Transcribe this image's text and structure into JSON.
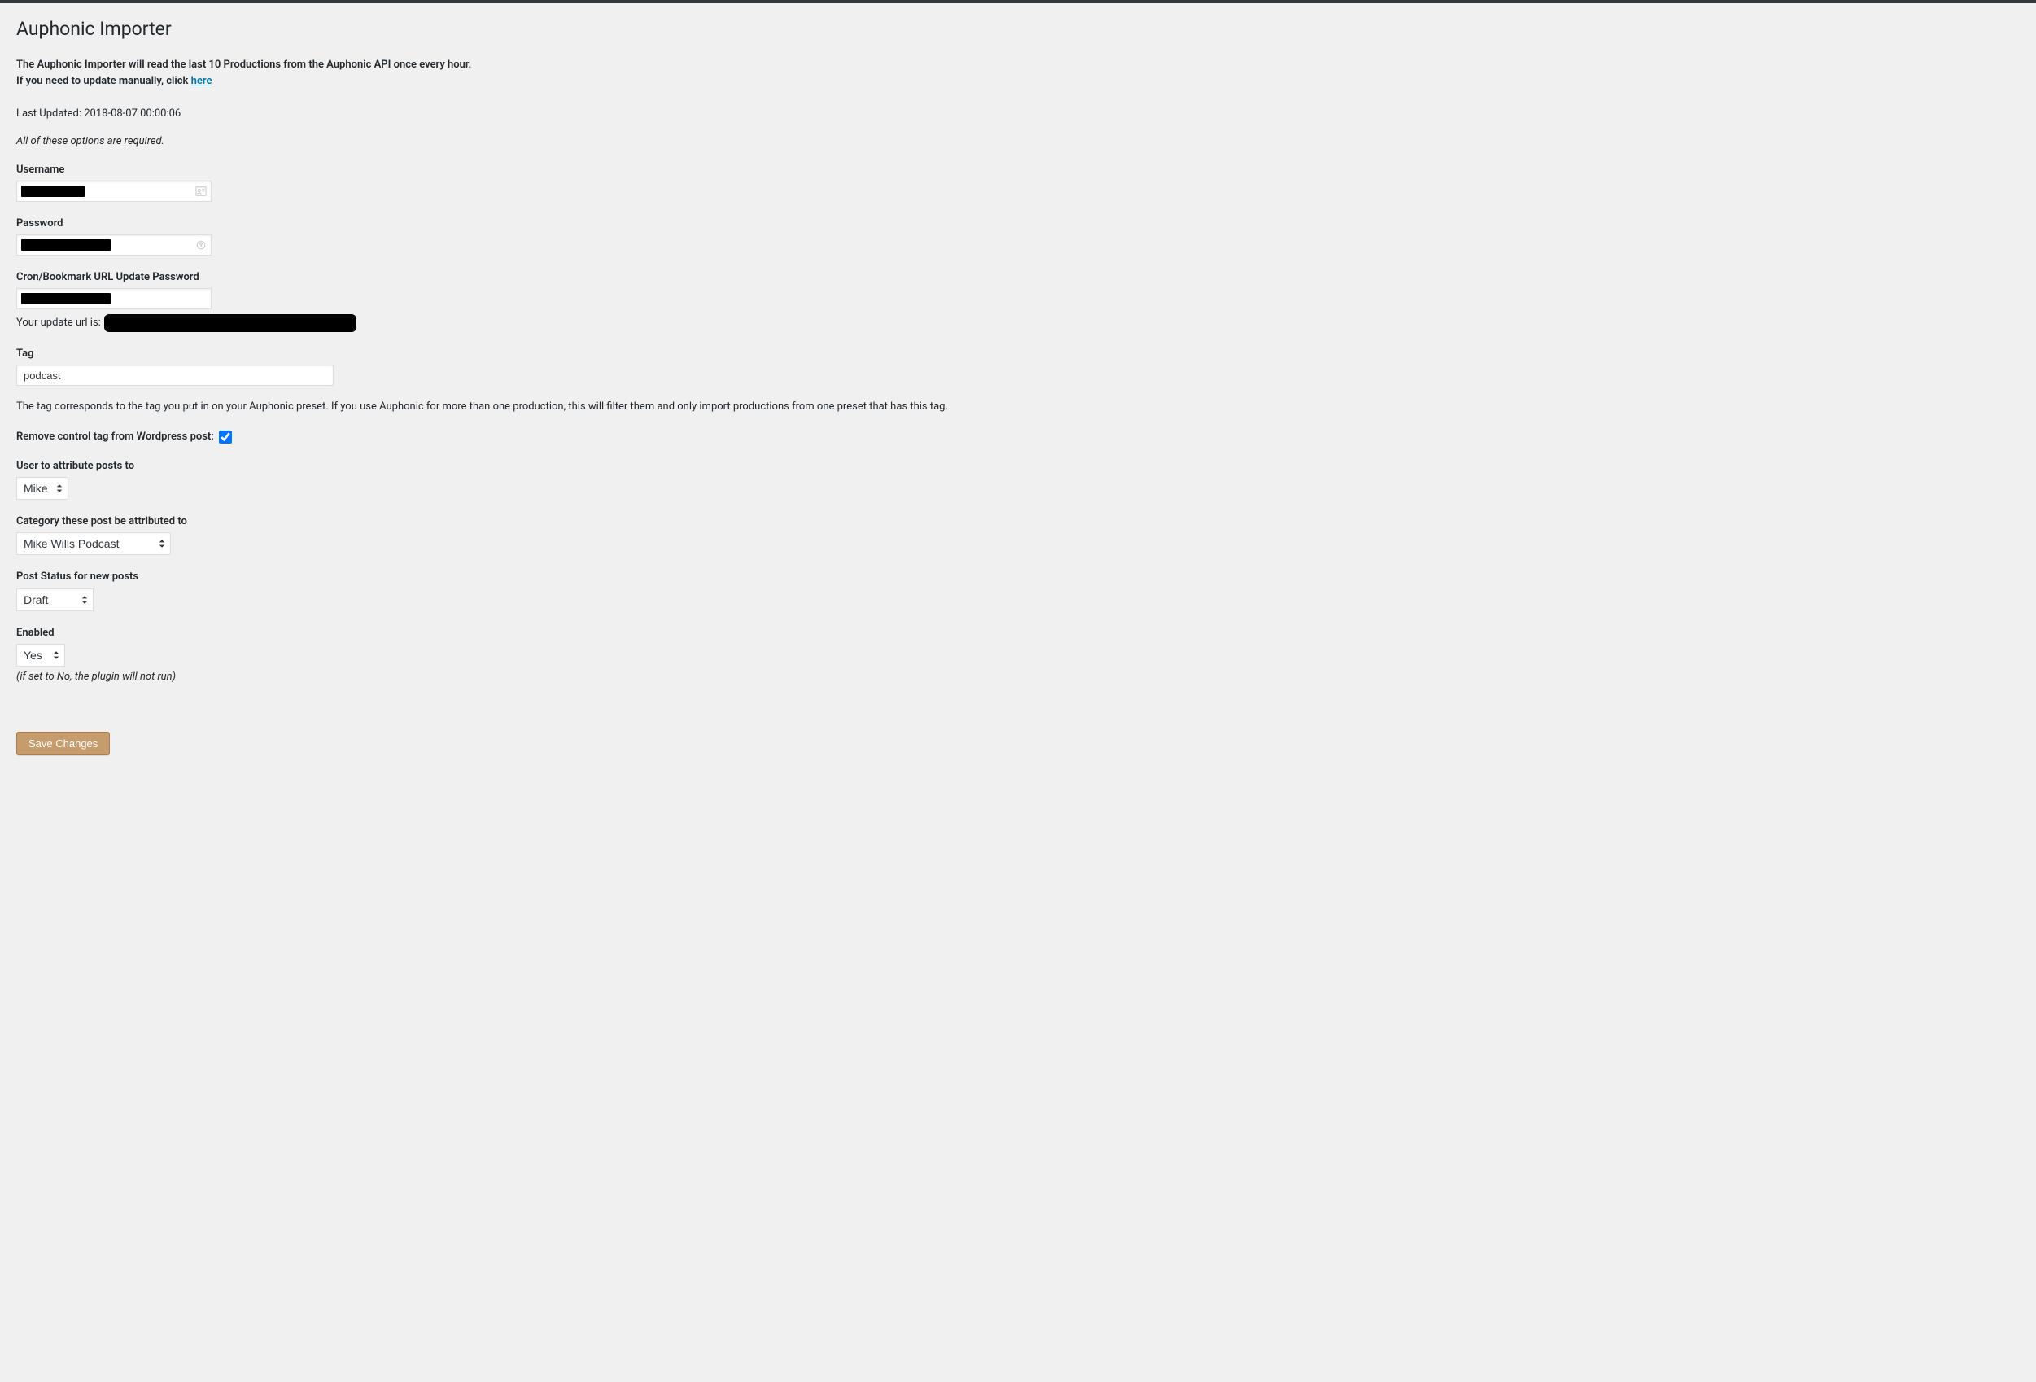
{
  "page": {
    "title": "Auphonic Importer",
    "intro_line1": "The Auphonic Importer will read the last 10 Productions from the Auphonic API once every hour.",
    "intro_line2_prefix": "If you need to update manually, click ",
    "intro_link_text": "here",
    "last_updated_label": "Last Updated: ",
    "last_updated_value": "2018-08-07 00:00:06",
    "required_note": "All of these options are required."
  },
  "fields": {
    "username": {
      "label": "Username",
      "value": ""
    },
    "password": {
      "label": "Password",
      "value": ""
    },
    "cron_password": {
      "label": "Cron/Bookmark URL Update Password",
      "value": "",
      "helper_prefix": "Your update url is: "
    },
    "tag": {
      "label": "Tag",
      "value": "podcast",
      "description": "The tag corresponds to the tag you put in on your Auphonic preset. If you use Auphonic for more than one production, this will filter them and only import productions from one preset that has this tag."
    },
    "remove_control_tag": {
      "label": "Remove control tag from Wordpress post:",
      "checked": true
    },
    "user_attribute": {
      "label": "User to attribute posts to",
      "selected": "Mike"
    },
    "category": {
      "label": "Category these post be attributed to",
      "selected": "Mike Wills Podcast"
    },
    "post_status": {
      "label": "Post Status for new posts",
      "selected": "Draft"
    },
    "enabled": {
      "label": "Enabled",
      "selected": "Yes",
      "note": "(if set to No, the plugin will not run)"
    }
  },
  "buttons": {
    "save": "Save Changes"
  }
}
